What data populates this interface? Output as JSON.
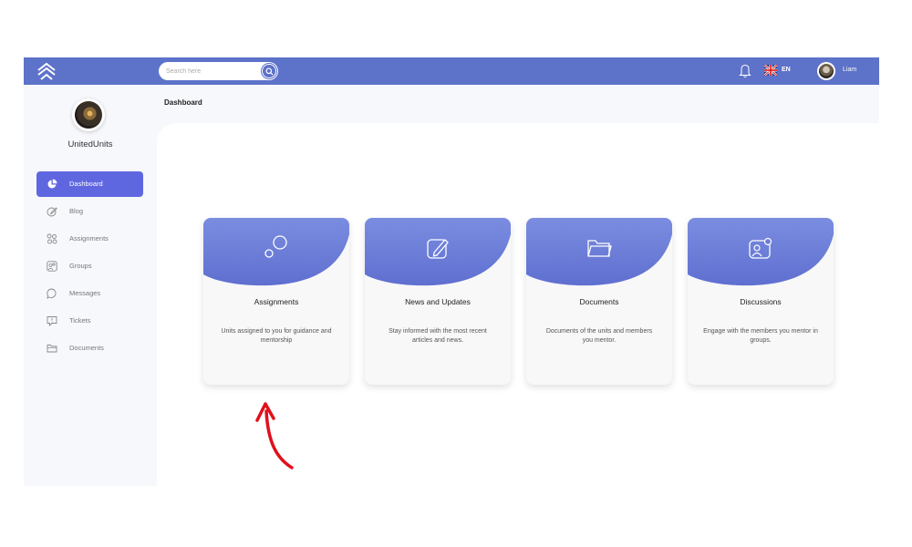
{
  "header": {
    "search_placeholder": "Search here",
    "language": "EN",
    "username": "Liam"
  },
  "sidebar": {
    "org_name": "UnitedUnits",
    "items": [
      {
        "label": "Dashboard",
        "icon": "pie-chart-icon",
        "active": true
      },
      {
        "label": "Blog",
        "icon": "edit-icon",
        "active": false
      },
      {
        "label": "Assignments",
        "icon": "assignments-icon",
        "active": false
      },
      {
        "label": "Groups",
        "icon": "groups-icon",
        "active": false
      },
      {
        "label": "Messages",
        "icon": "message-icon",
        "active": false
      },
      {
        "label": "Tickets",
        "icon": "ticket-icon",
        "active": false
      },
      {
        "label": "Documents",
        "icon": "folder-icon",
        "active": false
      }
    ]
  },
  "main": {
    "breadcrumb": "Dashboard",
    "cards": [
      {
        "title": "Assignments",
        "description": "Units assigned to you for guidance and mentorship",
        "icon": "bubbles-icon"
      },
      {
        "title": "News and Updates",
        "description": "Stay informed with the most recent articles and news.",
        "icon": "edit-icon"
      },
      {
        "title": "Documents",
        "description": "Documents of the units and members you mentor.",
        "icon": "folder-icon"
      },
      {
        "title": "Discussions",
        "description": "Engage with the members you mentor in groups.",
        "icon": "discussion-icon"
      }
    ]
  },
  "colors": {
    "topbar": "#5d72c9",
    "active_nav": "#5f67e0",
    "card_gradient_top": "#7b8de0",
    "card_gradient_bottom": "#5f6fd0",
    "arrow": "#e0101c"
  }
}
